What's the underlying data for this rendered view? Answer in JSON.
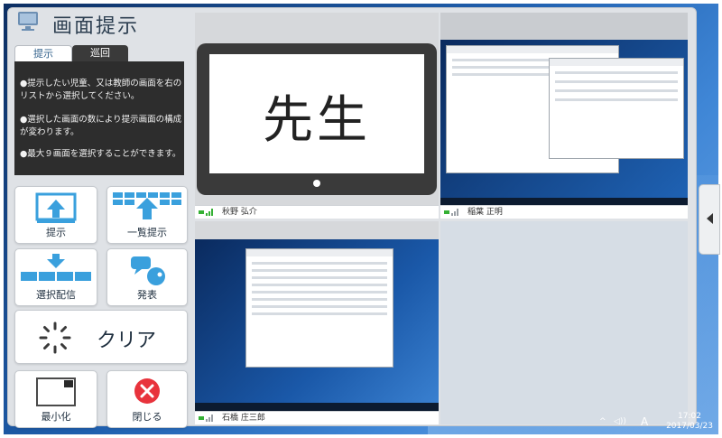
{
  "header": {
    "title": "画面提示"
  },
  "tabs": [
    {
      "label": "提示",
      "active": true
    },
    {
      "label": "巡回",
      "active": false
    }
  ],
  "instructions": [
    "●提示したい児童、又は教師の画面を右のリストから選択してください。",
    "●選択した画面の数により提示画面の構成が変わります。",
    "●最大９画面を選択することができます。"
  ],
  "buttons": {
    "present": "提示",
    "list_present": "一覧提示",
    "select_distribute": "選択配信",
    "announce": "発表",
    "clear": "クリア",
    "minimize": "最小化",
    "close": "閉じる"
  },
  "tiles": [
    {
      "name": "秋野 弘介",
      "screen_text": "先生"
    },
    {
      "name": "稲葉 正明"
    },
    {
      "name": "石橋 庄三郎"
    },
    {
      "name": ""
    }
  ],
  "tray": {
    "ime": "A",
    "time": "17:02",
    "date": "2017/03/23"
  },
  "colors": {
    "accent": "#4aa3df",
    "close_red": "#e8333c",
    "signal_green": "#35b034"
  }
}
